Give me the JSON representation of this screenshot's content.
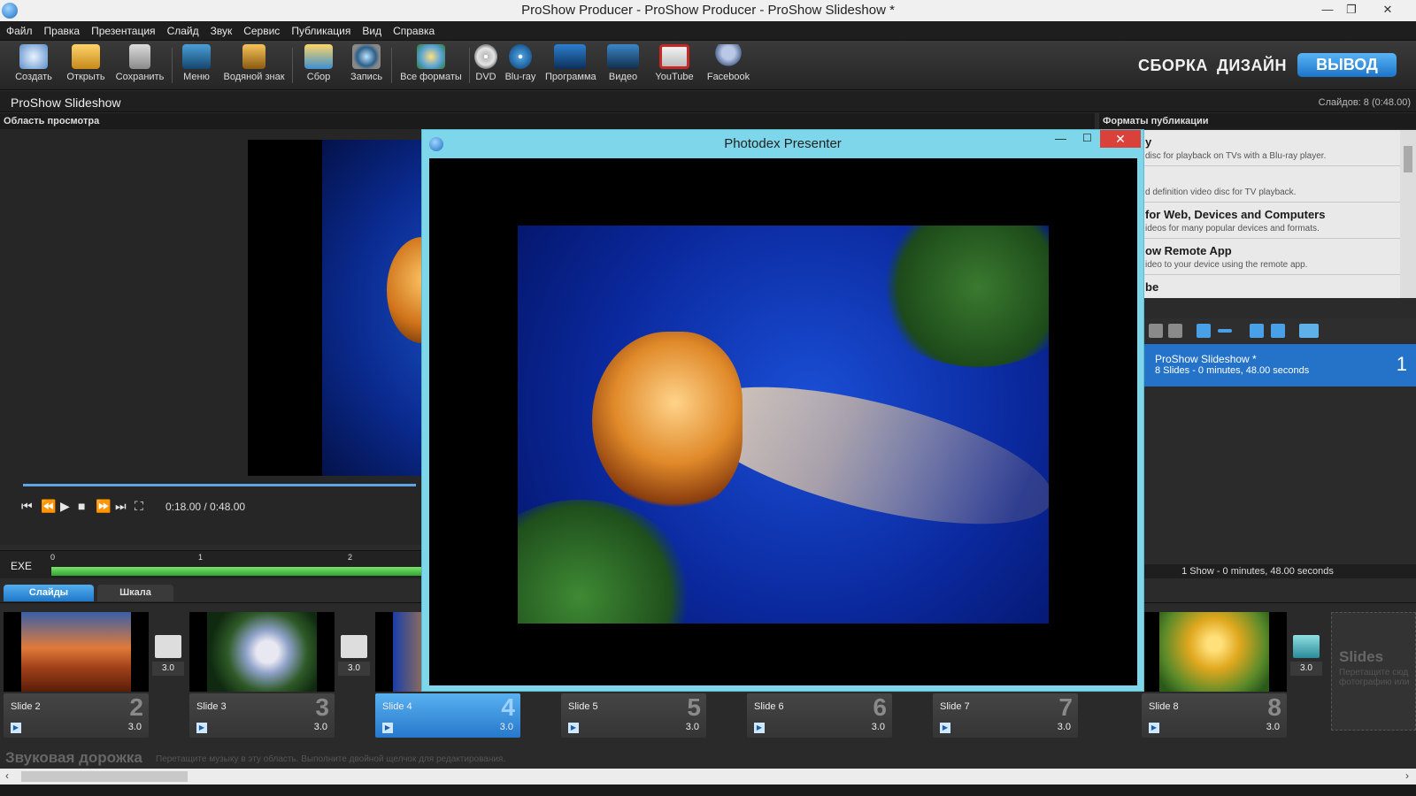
{
  "window": {
    "title": "ProShow Producer - ProShow Producer - ProShow Slideshow *"
  },
  "menu": [
    "Файл",
    "Правка",
    "Презентация",
    "Слайд",
    "Звук",
    "Сервис",
    "Публикация",
    "Вид",
    "Справка"
  ],
  "toolbar": {
    "tools": [
      {
        "label": "Создать",
        "icon": "create-icon"
      },
      {
        "label": "Открыть",
        "icon": "open-folder-icon"
      },
      {
        "label": "Сохранить",
        "icon": "save-icon"
      },
      {
        "label": "Меню",
        "icon": "menu-icon"
      },
      {
        "label": "Водяной знак",
        "icon": "watermark-icon"
      },
      {
        "label": "Сбор",
        "icon": "collect-icon"
      },
      {
        "label": "Запись",
        "icon": "record-camera-icon"
      },
      {
        "label": "Все форматы",
        "icon": "all-formats-icon"
      },
      {
        "label": "DVD",
        "icon": "dvd-icon"
      },
      {
        "label": "Blu-ray",
        "icon": "bluray-icon"
      },
      {
        "label": "Программа",
        "icon": "program-icon"
      },
      {
        "label": "Видео",
        "icon": "video-icon"
      },
      {
        "label": "YouTube",
        "icon": "youtube-icon"
      },
      {
        "label": "Facebook",
        "icon": "facebook-icon"
      }
    ],
    "modes": {
      "build": "СБОРКА",
      "design": "ДИЗАЙН",
      "output": "ВЫВОД"
    }
  },
  "show": {
    "name": "ProShow Slideshow",
    "slide_count": "Слайдов: 8 (0:48.00)"
  },
  "preview": {
    "header": "Область просмотра",
    "time": "0:18.00 / 0:48.00",
    "progress": 0.375,
    "exe_label": "EXE",
    "ticks": [
      "0",
      "1",
      "2"
    ]
  },
  "tabs": {
    "slides": "Слайды",
    "timeline": "Шкала"
  },
  "formats": {
    "header": "Форматы публикации",
    "items": [
      {
        "title": "y",
        "desc": "disc for playback on TVs with a Blu-ray player."
      },
      {
        "title": "",
        "desc": "d definition video disc for TV playback."
      },
      {
        "title": "for Web, Devices and Computers",
        "desc": "ideos for many popular devices and formats."
      },
      {
        "title": "ow Remote App",
        "desc": "ideo to your device using the remote app."
      },
      {
        "title": "be",
        "desc": ""
      }
    ]
  },
  "shows_panel": {
    "item_name": "ProShow Slideshow *",
    "item_info": "8 Slides - 0 minutes, 48.00 seconds",
    "item_number": "1",
    "status": "1 Show - 0 minutes, 48.00 seconds"
  },
  "slides": [
    {
      "label": "Slide 2",
      "number": "2",
      "duration": "3.0"
    },
    {
      "label": "Slide 3",
      "number": "3",
      "duration": "3.0"
    },
    {
      "label": "Slide 4",
      "number": "4",
      "duration": "3.0"
    },
    {
      "label": "Slide 5",
      "number": "5",
      "duration": "3.0"
    },
    {
      "label": "Slide 6",
      "number": "6",
      "duration": "3.0"
    },
    {
      "label": "Slide 7",
      "number": "7",
      "duration": "3.0"
    },
    {
      "label": "Slide 8",
      "number": "8",
      "duration": "3.0"
    }
  ],
  "transitions": [
    "3.0",
    "3.0",
    "3.0"
  ],
  "slides_drop": {
    "title": "Slides",
    "hint": "Перетащите сюд фотографию или"
  },
  "audio": {
    "title": "Звуковая дорожка",
    "hint": "Перетащите музыку в эту область. Выполните двойной щелчок для редактирования."
  },
  "presenter": {
    "title": "Photodex Presenter"
  }
}
